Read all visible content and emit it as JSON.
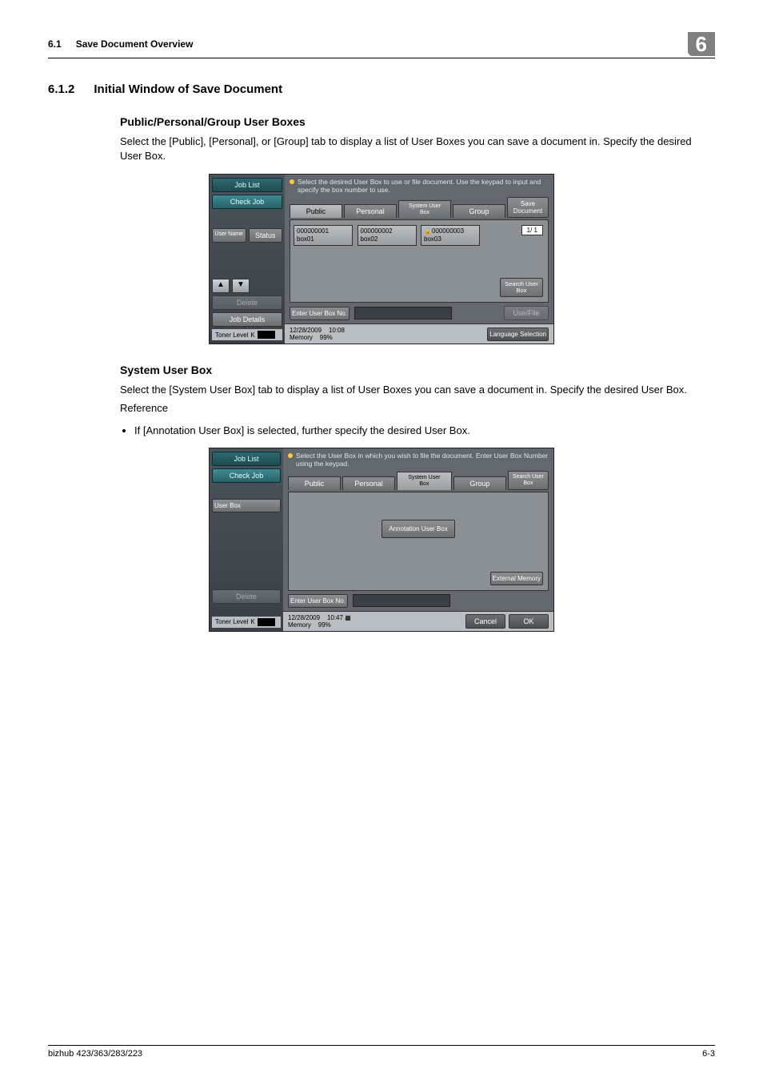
{
  "header": {
    "section": "6.1",
    "title": "Save Document Overview",
    "chapter": "6"
  },
  "h2": {
    "num": "6.1.2",
    "title": "Initial Window of Save Document"
  },
  "sub1": {
    "heading": "Public/Personal/Group User Boxes",
    "body": "Select the [Public], [Personal], or [Group] tab to display a list of User Boxes you can save a document in. Specify the desired User Box."
  },
  "sub2": {
    "heading": "System User Box",
    "body": "Select the [System User Box] tab to display a list of User Boxes you can save a document in. Specify the desired User Box.",
    "refLabel": "Reference",
    "bullet": "If [Annotation User Box] is selected, further specify the desired User Box."
  },
  "shot1": {
    "msg": "Select the desired User Box to use or file document. Use the keypad to input and specify the box number to use.",
    "left": {
      "jobList": "Job List",
      "checkJob": "Check Job",
      "userName": "User Name",
      "status": "Status",
      "delete": "Delete",
      "jobDetails": "Job Details",
      "toner": "Toner Level",
      "tonerK": "K"
    },
    "tabs": {
      "public": "Public",
      "personal": "Personal",
      "system": "System User Box",
      "group": "Group",
      "save": "Save Document"
    },
    "boxes": [
      {
        "num": "000000001",
        "name": "box01"
      },
      {
        "num": "000000002",
        "name": "box02"
      },
      {
        "num": "000000003",
        "name": "box03",
        "lock": true
      }
    ],
    "page": "1/  1",
    "search": "Search User Box",
    "enter": "Enter User Box No.",
    "useFile": "Use/File",
    "status": {
      "date": "12/28/2009",
      "time": "10:08",
      "mem": "Memory",
      "memv": "99%",
      "lang": "Language Selection"
    }
  },
  "shot2": {
    "msg": "Select the User Box in which you wish to file the document.  Enter User Box Number using the keypad.",
    "left": {
      "jobList": "Job List",
      "checkJob": "Check Job",
      "userBox": "User Box",
      "delete": "Delete",
      "toner": "Toner Level",
      "tonerK": "K"
    },
    "tabs": {
      "public": "Public",
      "personal": "Personal",
      "system": "System User Box",
      "group": "Group",
      "search": "Search User Box"
    },
    "ann": "Annotation User Box",
    "ext": "External Memory",
    "enter": "Enter User Box No.",
    "status": {
      "date": "12/28/2009",
      "time": "10:47",
      "mem": "Memory",
      "memv": "99%",
      "cancel": "Cancel",
      "ok": "OK"
    }
  },
  "footer": {
    "left": "bizhub 423/363/283/223",
    "right": "6-3"
  }
}
